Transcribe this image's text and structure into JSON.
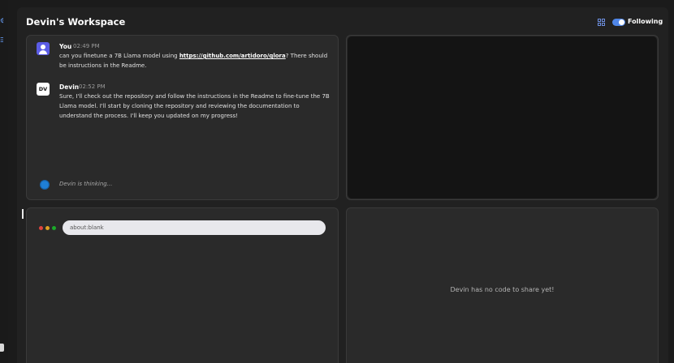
{
  "workspace": {
    "title": "Devin's Workspace"
  },
  "header": {
    "following_label": "Following",
    "following_on": true,
    "grid_icon": "grid-icon",
    "accent": "#4f86e8"
  },
  "chat": {
    "messages": [
      {
        "sender": "You",
        "time": "02:49 PM",
        "text_before": "can you finetune a 7B Llama model using ",
        "link": "https://github.com/artidoro/qlora",
        "text_after": "? There should be instructions in the Readme."
      },
      {
        "sender": "Devin",
        "avatar": "DV",
        "time": "02:52 PM",
        "text": "Sure, I'll check out the repository and follow the instructions in the Readme to fine-tune the 7B Llama model. I'll start by cloning the repository and reviewing the documentation to understand the process. I'll keep you updated on my progress!"
      }
    ],
    "thinking": "Devin is thinking..."
  },
  "browser": {
    "url": "about:blank",
    "dot_colors": [
      "#e0443e",
      "#dea123",
      "#1aab29"
    ]
  },
  "editor": {
    "empty_message": "Devin has no code to share yet!"
  }
}
